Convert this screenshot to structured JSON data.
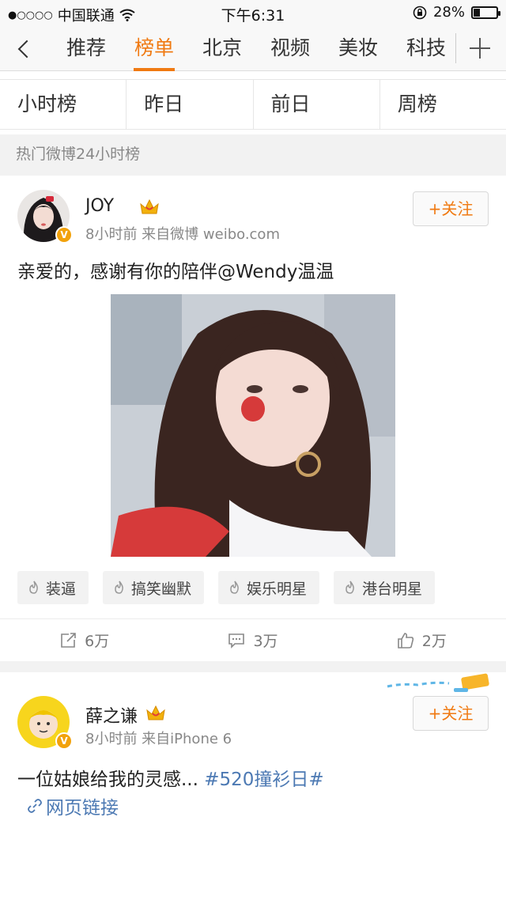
{
  "status_bar": {
    "signal": "●○○○○",
    "carrier": "中国联通",
    "time": "下午6:31",
    "battery_percent": "28%",
    "battery_level": 0.28
  },
  "nav": {
    "tabs": [
      "推荐",
      "榜单",
      "北京",
      "视频",
      "美妆",
      "科技"
    ],
    "active_tab": "榜单"
  },
  "subnav": [
    "小时榜",
    "昨日",
    "前日",
    "周榜"
  ],
  "section_label": "热门微博24小时榜",
  "posts": [
    {
      "username": "JOY",
      "meta": "8小时前  来自微博 weibo.com",
      "follow_label": "+关注",
      "content": "亲爱的，感谢有你的陪伴@Wendy温温",
      "tags": [
        "装逼",
        "搞笑幽默",
        "娱乐明星",
        "港台明星"
      ],
      "reposts": "6万",
      "comments": "3万",
      "likes": "2万"
    },
    {
      "username": "薛之谦",
      "meta": "8小时前  来自iPhone 6",
      "follow_label": "+关注",
      "content": "一位姑娘给我的灵感...",
      "hashtag": "#520撞衫日#",
      "link_text": "网页链接"
    }
  ],
  "colors": {
    "accent": "#f07a12",
    "link": "#4c79b3",
    "badge": "#f2a20c"
  }
}
